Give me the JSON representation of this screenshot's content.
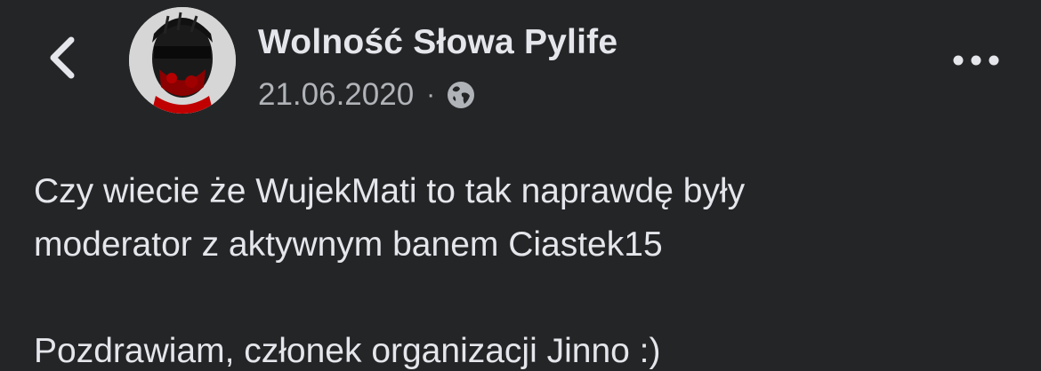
{
  "post": {
    "author": "Wolność Słowa Pylife",
    "date": "21.06.2020",
    "separator": "·",
    "privacy_icon": "globe-icon",
    "body_lines": [
      "Czy wiecie że WujekMati to tak naprawdę były",
      "moderator z aktywnym banem Ciastek15"
    ],
    "closing_line": "Pozdrawiam, członek organizacji Jinno :)"
  },
  "icons": {
    "back": "chevron-left-icon",
    "more": "more-horizontal-icon"
  },
  "colors": {
    "background": "#242526",
    "primary_text": "#e4e6eb",
    "secondary_text": "#b0b3b8"
  }
}
